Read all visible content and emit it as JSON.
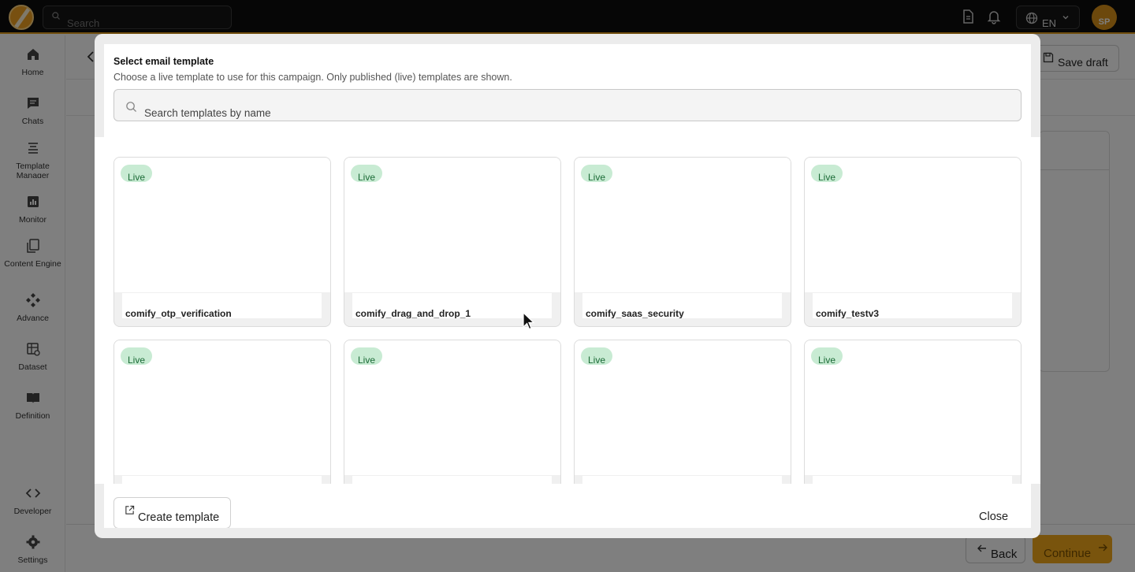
{
  "topbar": {
    "search_placeholder": "Search",
    "language": "EN",
    "avatar_initials": "SP"
  },
  "sidebar": {
    "items": [
      {
        "label": "Home",
        "icon": "home-icon"
      },
      {
        "label": "Chats",
        "icon": "chat-icon"
      },
      {
        "label": "Template Manager",
        "icon": "template-icon"
      },
      {
        "label": "Monitor",
        "icon": "monitor-icon"
      },
      {
        "label": "Content Engine",
        "icon": "content-icon"
      },
      {
        "label": "Advance",
        "icon": "advance-icon"
      },
      {
        "label": "Dataset",
        "icon": "dataset-icon"
      },
      {
        "label": "Definition",
        "icon": "definition-icon"
      },
      {
        "label": "Developer",
        "icon": "code-icon"
      },
      {
        "label": "Settings",
        "icon": "gear-icon"
      }
    ]
  },
  "page": {
    "save_draft": "Save draft",
    "back": "Back",
    "continue": "Continue"
  },
  "modal": {
    "title": "Select email template",
    "subtitle": "Choose a live template to use for this campaign. Only published (live) templates are shown.",
    "search_placeholder": "Search templates by name",
    "cards": [
      {
        "status": "Live",
        "name": "comify_otp_verification"
      },
      {
        "status": "Live",
        "name": "comify_drag_and_drop_1"
      },
      {
        "status": "Live",
        "name": "comify_saas_security"
      },
      {
        "status": "Live",
        "name": "comify_testv3"
      },
      {
        "status": "Live",
        "name": ""
      },
      {
        "status": "Live",
        "name": ""
      },
      {
        "status": "Live",
        "name": ""
      },
      {
        "status": "Live",
        "name": ""
      }
    ],
    "create_template": "Create template",
    "close": "Close"
  },
  "colors": {
    "accent": "#f3a81a",
    "live_badge_bg": "#c8ebd3",
    "live_badge_text": "#1b6b36",
    "topbar_bg": "#0c0c0c"
  }
}
